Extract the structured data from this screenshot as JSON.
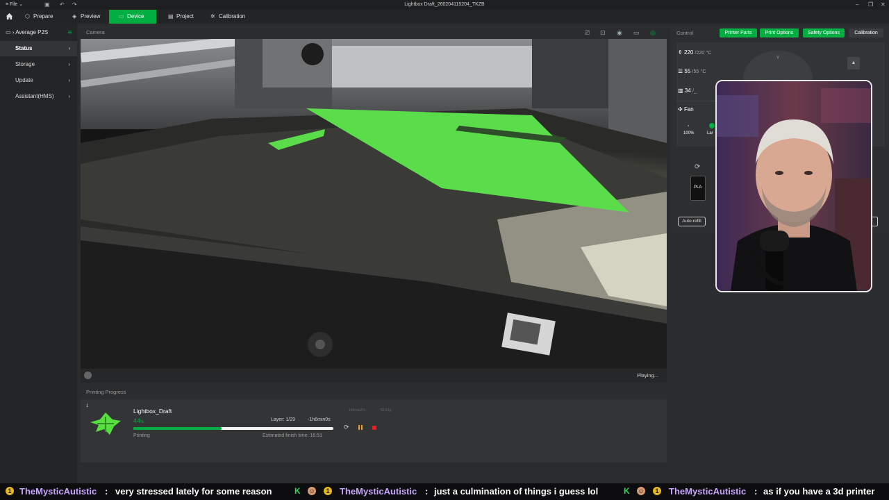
{
  "window": {
    "title": "Lightbox Draft_260204115204_TKZB",
    "file_menu": "File"
  },
  "tabs": [
    {
      "label": "Prepare",
      "icon": "cube-icon"
    },
    {
      "label": "Preview",
      "icon": "preview-icon"
    },
    {
      "label": "Device",
      "icon": "monitor-icon",
      "active": true
    },
    {
      "label": "Project",
      "icon": "project-icon"
    },
    {
      "label": "Calibration",
      "icon": "calibration-icon"
    }
  ],
  "sidebar": {
    "device_name": "Average P2S",
    "items": [
      {
        "label": "Status",
        "active": true
      },
      {
        "label": "Storage"
      },
      {
        "label": "Update"
      },
      {
        "label": "Assistant(HMS)"
      }
    ]
  },
  "camera": {
    "label": "Camera",
    "status": "Playing..."
  },
  "progress": {
    "section_label": "Printing Progress",
    "plate": "1",
    "job_name": "Lightbox_Draft",
    "percent_text": "44",
    "percent_unit": "%",
    "percent_fraction": 0.44,
    "layer": "Layer: 1/29",
    "remaining": "-1h6min0s",
    "elapsed": "1h6min27s",
    "weight": "53.81g",
    "state": "Printing",
    "finish": "Estimated finish time: 16:51"
  },
  "control": {
    "label": "Control",
    "buttons": [
      "Printer Parts",
      "Print Options",
      "Safety Options",
      "Calibration"
    ],
    "nozzle_temp": "220",
    "nozzle_target": "/220",
    "bed_temp": "55",
    "bed_target": "/55",
    "chamber_temp": "34",
    "chamber_target": "/_",
    "temp_unit": "°C",
    "fan_label": "Fan",
    "fan_value": "100%",
    "fan_partial": "Lar",
    "filament": "PLA",
    "auto_refill": "Auto-refill",
    "joystick_y": "Y"
  },
  "ticker": [
    {
      "name": "TheMysticAutistic",
      "msg": "very stressed lately for some reason"
    },
    {
      "name": "TheMysticAutistic",
      "msg": "just a culmination of things i guess lol"
    },
    {
      "name": "TheMysticAutistic",
      "msg": "as if you have a 3d printer"
    }
  ],
  "colors": {
    "accent": "#00ae42",
    "pause": "#f0a020",
    "stop": "#e02020"
  }
}
